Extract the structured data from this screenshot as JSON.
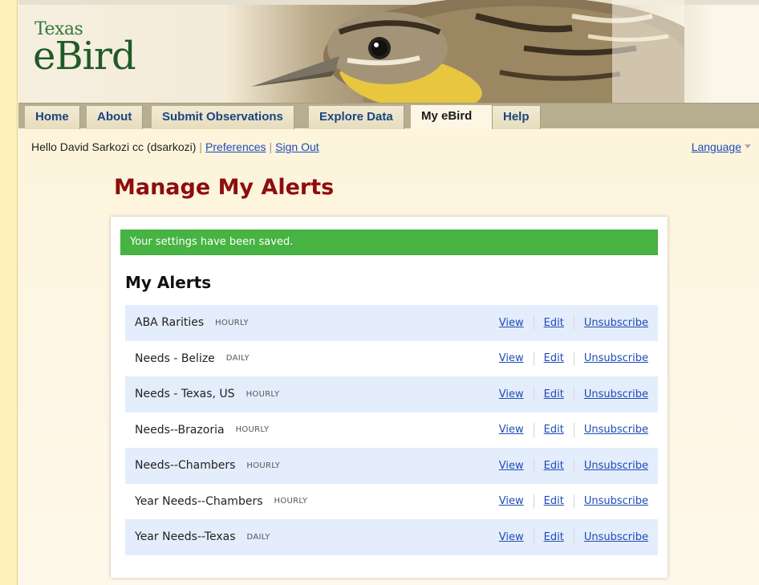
{
  "brand": {
    "small": "Texas",
    "large": "eBird"
  },
  "nav": {
    "tabs": [
      {
        "label": "Home",
        "active": false
      },
      {
        "label": "About",
        "active": false
      },
      {
        "label": "Submit Observations",
        "active": false
      },
      {
        "label": "Explore Data",
        "active": false
      },
      {
        "label": "My eBird",
        "active": true
      },
      {
        "label": "Help",
        "active": false
      }
    ]
  },
  "user": {
    "greeting": "Hello David Sarkozi cc (dsarkozi)",
    "preferences": "Preferences",
    "sign_out": "Sign Out",
    "language": "Language"
  },
  "page_title": "Manage My Alerts",
  "notice": "Your settings have been saved.",
  "section_title": "My Alerts",
  "alerts": [
    {
      "name": "ABA Rarities",
      "frequency": "HOURLY",
      "view": "View",
      "edit": "Edit",
      "unsubscribe": "Unsubscribe"
    },
    {
      "name": "Needs - Belize",
      "frequency": "DAILY",
      "view": "View",
      "edit": "Edit",
      "unsubscribe": "Unsubscribe"
    },
    {
      "name": "Needs - Texas, US",
      "frequency": "HOURLY",
      "view": "View",
      "edit": "Edit",
      "unsubscribe": "Unsubscribe"
    },
    {
      "name": "Needs--Brazoria",
      "frequency": "HOURLY",
      "view": "View",
      "edit": "Edit",
      "unsubscribe": "Unsubscribe"
    },
    {
      "name": "Needs--Chambers",
      "frequency": "HOURLY",
      "view": "View",
      "edit": "Edit",
      "unsubscribe": "Unsubscribe"
    },
    {
      "name": "Year Needs--Chambers",
      "frequency": "HOURLY",
      "view": "View",
      "edit": "Edit",
      "unsubscribe": "Unsubscribe"
    },
    {
      "name": "Year Needs--Texas",
      "frequency": "DAILY",
      "view": "View",
      "edit": "Edit",
      "unsubscribe": "Unsubscribe"
    }
  ],
  "colors": {
    "title": "#8e0d0d",
    "notice_bg": "#46b342",
    "link": "#1e4bb8",
    "row_alt": "#e4edfb"
  },
  "icons": {
    "language_caret": "caret-down-icon",
    "header_image": "meadowlark-bird"
  }
}
